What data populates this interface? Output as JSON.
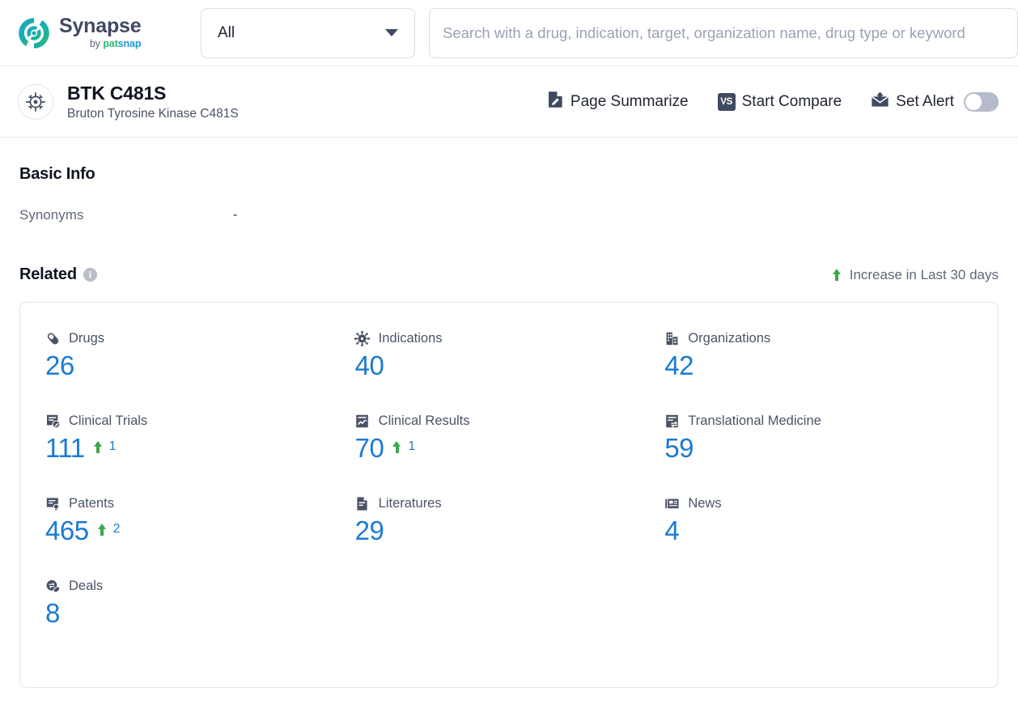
{
  "brand": {
    "name": "Synapse",
    "by": "by ",
    "pat": "pat",
    "snap": "snap"
  },
  "search": {
    "filter_label": "All",
    "placeholder": "Search with a drug, indication, target, organization name, drug type or keyword",
    "value": ""
  },
  "entity": {
    "title": "BTK C481S",
    "subtitle": "Bruton Tyrosine Kinase C481S",
    "actions": [
      {
        "label": "Page Summarize",
        "icon": "document-pen-icon"
      },
      {
        "label": "Start Compare",
        "icon": "vs-badge-icon"
      },
      {
        "label": "Set Alert",
        "icon": "alert-mail-icon"
      }
    ],
    "alert_toggle_on": false
  },
  "basic_info": {
    "title": "Basic Info",
    "synonyms_label": "Synonyms",
    "synonyms_value": "-"
  },
  "related": {
    "title": "Related",
    "info_glyph": "i",
    "legend": "Increase in Last 30 days",
    "stats": [
      {
        "label": "Drugs",
        "value": "26",
        "delta": "",
        "icon": "pill-icon"
      },
      {
        "label": "Indications",
        "value": "40",
        "delta": "",
        "icon": "virus-icon"
      },
      {
        "label": "Organizations",
        "value": "42",
        "delta": "",
        "icon": "building-icon"
      },
      {
        "label": "Clinical Trials",
        "value": "111",
        "delta": "1",
        "icon": "clinical-trial-icon"
      },
      {
        "label": "Clinical Results",
        "value": "70",
        "delta": "1",
        "icon": "clinical-result-icon"
      },
      {
        "label": "Translational Medicine",
        "value": "59",
        "delta": "",
        "icon": "translational-icon"
      },
      {
        "label": "Patents",
        "value": "465",
        "delta": "2",
        "icon": "patent-icon"
      },
      {
        "label": "Literatures",
        "value": "29",
        "delta": "",
        "icon": "literature-icon"
      },
      {
        "label": "News",
        "value": "4",
        "delta": "",
        "icon": "news-icon"
      },
      {
        "label": "Deals",
        "value": "8",
        "delta": "",
        "icon": "deals-icon"
      }
    ]
  },
  "colors": {
    "accent_blue": "#1b7ad4",
    "increase_green": "#3aa94a",
    "icon_slate": "#4a5365",
    "text_dark": "#0f1420"
  }
}
